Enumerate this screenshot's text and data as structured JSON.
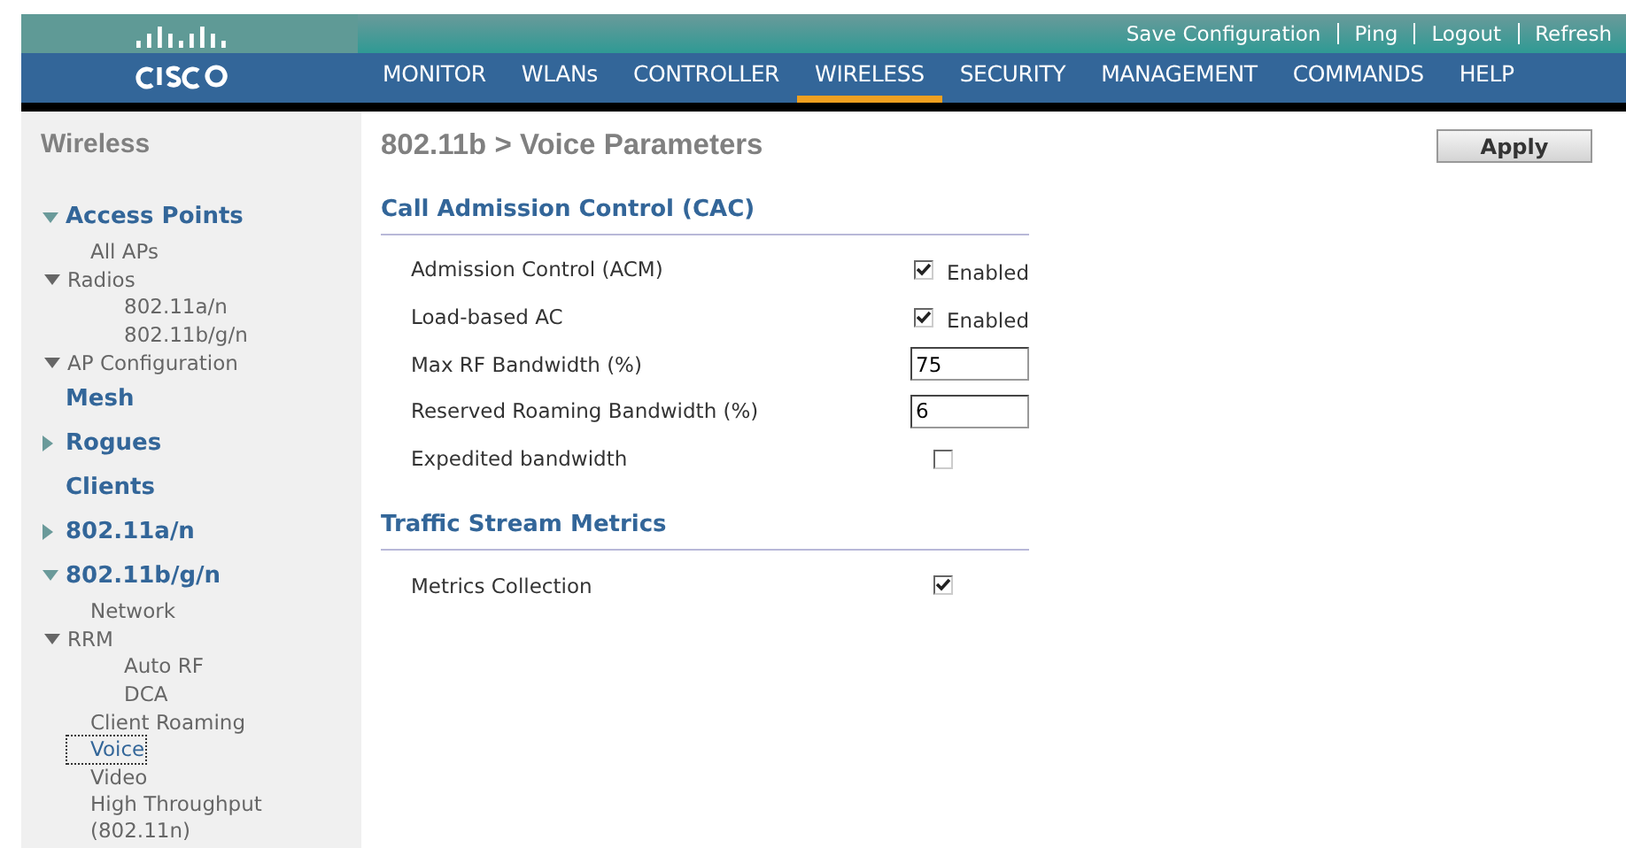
{
  "header": {
    "top_links": [
      "Save Configuration",
      "Ping",
      "Logout",
      "Refresh"
    ],
    "nav": [
      {
        "label": "MONITOR",
        "selected": false
      },
      {
        "label": "WLANs",
        "selected": false
      },
      {
        "label": "CONTROLLER",
        "selected": false
      },
      {
        "label": "WIRELESS",
        "selected": true
      },
      {
        "label": "SECURITY",
        "selected": false
      },
      {
        "label": "MANAGEMENT",
        "selected": false
      },
      {
        "label": "COMMANDS",
        "selected": false
      },
      {
        "label": "HELP",
        "selected": false
      }
    ]
  },
  "sidebar": {
    "title": "Wireless",
    "items": [
      {
        "label": "Access Points",
        "expanded": true,
        "selected": false,
        "children": [
          {
            "label": "All APs",
            "selected": false
          },
          {
            "label": "Radios",
            "expanded": true,
            "selected": false,
            "children": [
              {
                "label": "802.11a/n",
                "selected": false
              },
              {
                "label": "802.11b/g/n",
                "selected": false
              }
            ]
          },
          {
            "label": "AP Configuration",
            "expanded": true,
            "selected": false
          }
        ]
      },
      {
        "label": "Mesh",
        "selected": false
      },
      {
        "label": "Rogues",
        "expanded": false,
        "selected": false
      },
      {
        "label": "Clients",
        "selected": false
      },
      {
        "label": "802.11a/n",
        "expanded": false,
        "selected": false
      },
      {
        "label": "802.11b/g/n",
        "expanded": true,
        "selected": false,
        "children": [
          {
            "label": "Network",
            "selected": false
          },
          {
            "label": "RRM",
            "expanded": true,
            "selected": false,
            "children": [
              {
                "label": "Auto RF",
                "selected": false
              },
              {
                "label": "DCA",
                "selected": false
              }
            ]
          },
          {
            "label": "Client Roaming",
            "selected": false
          },
          {
            "label": "Voice",
            "selected": true
          },
          {
            "label": "Video",
            "selected": false
          },
          {
            "label": "High Throughput (802.11n)",
            "selected": false
          }
        ]
      }
    ]
  },
  "page": {
    "title": "802.11b > Voice Parameters",
    "apply_button": "Apply",
    "sections": [
      {
        "title": "Call Admission Control (CAC)",
        "rows": [
          {
            "label": "Admission Control (ACM)",
            "kind": "checkbox",
            "checked": true,
            "suffix": "Enabled"
          },
          {
            "label": "Load-based AC",
            "kind": "checkbox",
            "checked": true,
            "suffix": "Enabled"
          },
          {
            "label": "Max RF Bandwidth (%)",
            "kind": "input",
            "value": "75"
          },
          {
            "label": "Reserved Roaming Bandwidth (%)",
            "kind": "input",
            "value": "6"
          },
          {
            "label": "Expedited bandwidth",
            "kind": "checkbox",
            "checked": false
          }
        ]
      },
      {
        "title": "Traffic Stream Metrics",
        "rows": [
          {
            "label": "Metrics Collection",
            "kind": "checkbox",
            "checked": true
          }
        ]
      }
    ]
  }
}
